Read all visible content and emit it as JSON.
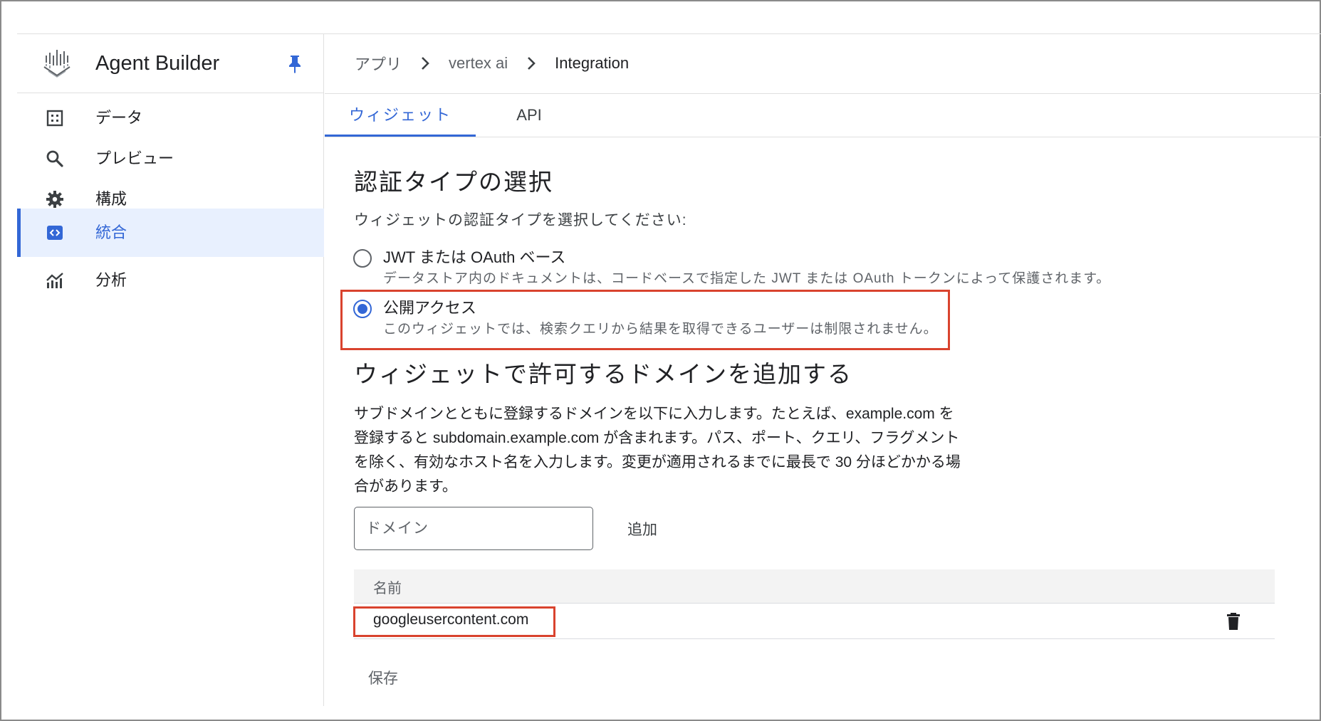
{
  "app": {
    "title": "Agent Builder"
  },
  "sidebar": {
    "items": [
      {
        "label": "データ",
        "icon": "data-grid-icon",
        "active": false
      },
      {
        "label": "プレビュー",
        "icon": "search-icon",
        "active": false
      },
      {
        "label": "構成",
        "icon": "gear-icon",
        "active": false
      },
      {
        "label": "統合",
        "icon": "code-icon",
        "active": true
      },
      {
        "label": "分析",
        "icon": "analytics-icon",
        "active": false
      }
    ]
  },
  "breadcrumb": {
    "items": [
      "アプリ",
      "vertex ai",
      "Integration"
    ]
  },
  "tabs": [
    {
      "label": "ウィジェット",
      "active": true
    },
    {
      "label": "API",
      "active": false
    }
  ],
  "auth": {
    "title": "認証タイプの選択",
    "prompt": "ウィジェットの認証タイプを選択してください:",
    "options": [
      {
        "label": "JWT または OAuth ベース",
        "description": "データストア内のドキュメントは、コードベースで指定した JWT または OAuth トークンによって保護されます。",
        "selected": false
      },
      {
        "label": "公開アクセス",
        "description": "このウィジェットでは、検索クエリから結果を取得できるユーザーは制限されません。",
        "selected": true
      }
    ]
  },
  "domains": {
    "title": "ウィジェットで許可するドメインを追加する",
    "description": "サブドメインとともに登録するドメインを以下に入力します。たとえば、example.com を登録すると subdomain.example.com が含まれます。パス、ポート、クエリ、フラグメントを除く、有効なホスト名を入力します。変更が適用されるまでに最長で 30 分ほどかかる場合があります。",
    "input_placeholder": "ドメイン",
    "input_value": "",
    "add_label": "追加",
    "table": {
      "header": "名前",
      "rows": [
        {
          "name": "googleusercontent.com"
        }
      ]
    },
    "save_label": "保存"
  },
  "colors": {
    "accent": "#3367d6",
    "highlight": "#d9432e"
  }
}
